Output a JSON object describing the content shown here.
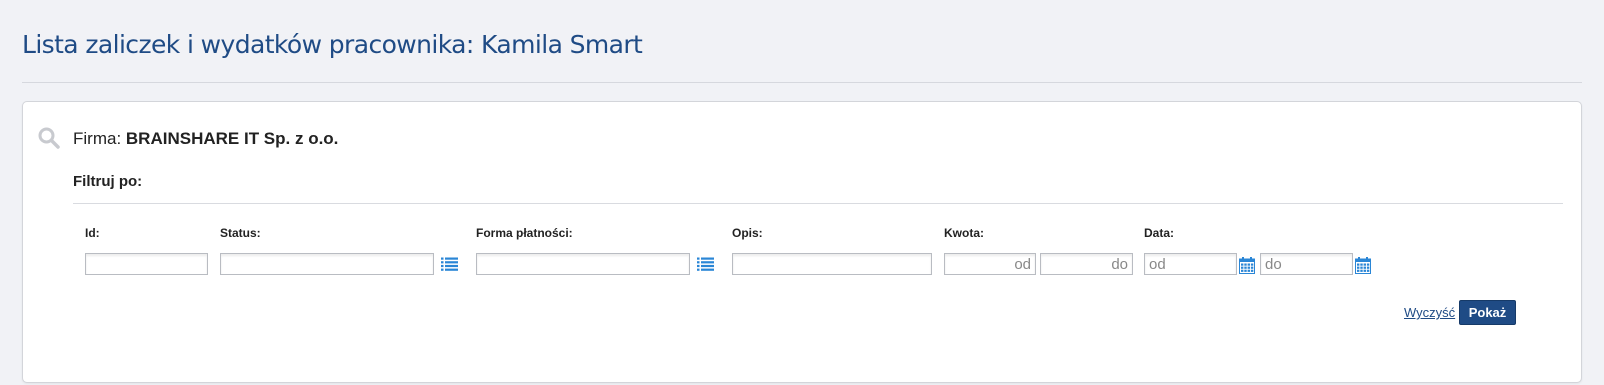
{
  "header": {
    "title": "Lista zaliczek i wydatków pracownika: Kamila Smart"
  },
  "company": {
    "label": "Firma:",
    "name": "BRAINSHARE IT Sp. z o.o."
  },
  "filter": {
    "heading": "Filtruj po:",
    "fields": {
      "id": {
        "label": "Id:",
        "value": ""
      },
      "status": {
        "label": "Status:",
        "value": ""
      },
      "payment_form": {
        "label": "Forma płatności:",
        "value": ""
      },
      "description": {
        "label": "Opis:",
        "value": ""
      },
      "amount": {
        "label": "Kwota:",
        "from_placeholder": "od",
        "to_placeholder": "do"
      },
      "date": {
        "label": "Data:",
        "from_placeholder": "od",
        "to_placeholder": "do"
      }
    },
    "actions": {
      "clear_label": "Wyczyść",
      "show_label": "Pokaż"
    }
  },
  "colors": {
    "accent": "#1f4b85",
    "icon_blue": "#2a86d6",
    "background": "#f1f2f6"
  },
  "icons": {
    "search": "search-icon",
    "list": "list-icon",
    "calendar": "calendar-icon"
  }
}
